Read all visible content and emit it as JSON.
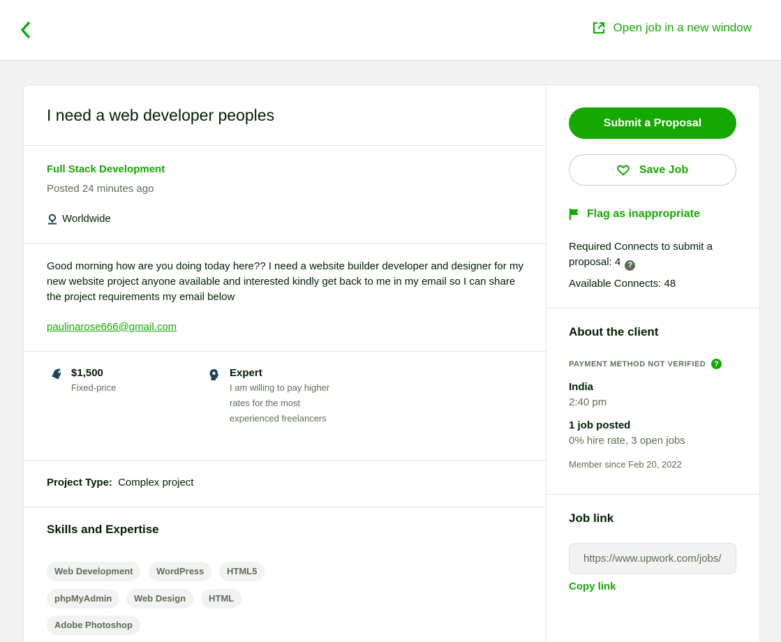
{
  "header": {
    "back_icon": "chevron-left-icon",
    "open_window_label": "Open job in a new window",
    "open_window_icon": "external-link-icon"
  },
  "job": {
    "title": "I need a web developer peoples",
    "category": "Full Stack Development",
    "posted": "Posted 24 minutes ago",
    "location": "Worldwide",
    "description": "Good morning how are you doing today here?? I need a website builder developer and designer for my new website project anyone available and interested kindly get back to me in my email so I can  share the project requirements my email below",
    "email": "paulinarose666@gmail.com",
    "budget": "$1,500",
    "budget_type": "Fixed-price",
    "level": "Expert",
    "level_desc": "I am willing to pay higher rates for the most experienced freelancers",
    "project_type_label": "Project Type:",
    "project_type": "Complex project",
    "skills_heading": "Skills and Expertise",
    "skills": [
      "Web Development",
      "WordPress",
      "HTML5",
      "phpMyAdmin",
      "Web Design",
      "HTML",
      "Adobe Photoshop"
    ]
  },
  "sidebar": {
    "submit_label": "Submit a Proposal",
    "save_label": "Save Job",
    "flag_label": "Flag as inappropriate",
    "connects_required": "Required Connects to submit a proposal: 4",
    "connects_available": "Available Connects: 48",
    "about_heading": "About the client",
    "payment_status": "PAYMENT METHOD NOT VERIFIED",
    "client_country": "India",
    "client_time": "2:40 pm",
    "client_jobs": "1 job posted",
    "client_hire": "0% hire rate, 3 open jobs",
    "client_member": "Member since Feb 20, 2022",
    "joblink_heading": "Job link",
    "joblink_value": "https://www.upwork.com/jobs/",
    "copy_label": "Copy link"
  },
  "colors": {
    "brand": "#14a800",
    "text": "#001e00",
    "muted": "#5e6d55"
  }
}
